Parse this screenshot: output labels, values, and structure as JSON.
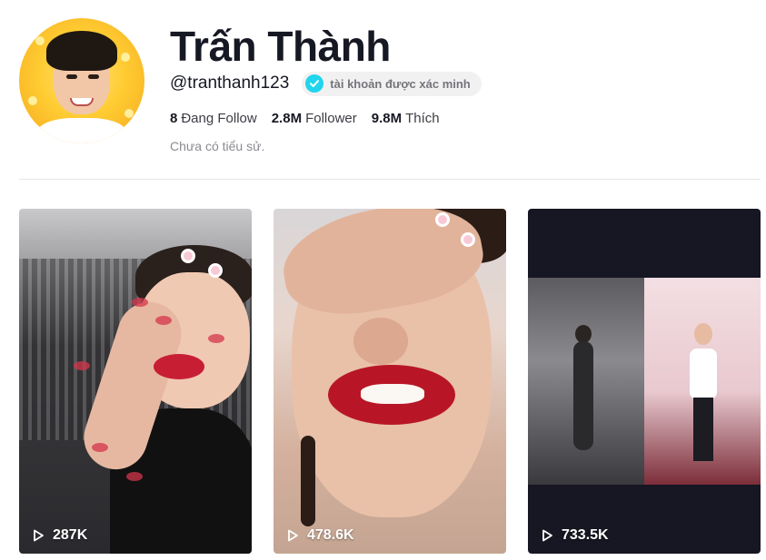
{
  "profile": {
    "name": "Trấn Thành",
    "handle": "@tranthanh123",
    "verified_label": "tài khoản được xác minh",
    "stats": [
      {
        "value": "8",
        "label": "Đang Follow"
      },
      {
        "value": "2.8M",
        "label": "Follower"
      },
      {
        "value": "9.8M",
        "label": "Thích"
      }
    ],
    "bio": "Chưa có tiểu sử."
  },
  "videos": [
    {
      "views": "287K"
    },
    {
      "views": "478.6K"
    },
    {
      "views": "733.5K"
    }
  ],
  "colors": {
    "verified": "#20d5ec",
    "text": "#161823",
    "muted": "#8a8b91"
  },
  "icons": {
    "verified": "check-icon",
    "play": "play-icon"
  }
}
